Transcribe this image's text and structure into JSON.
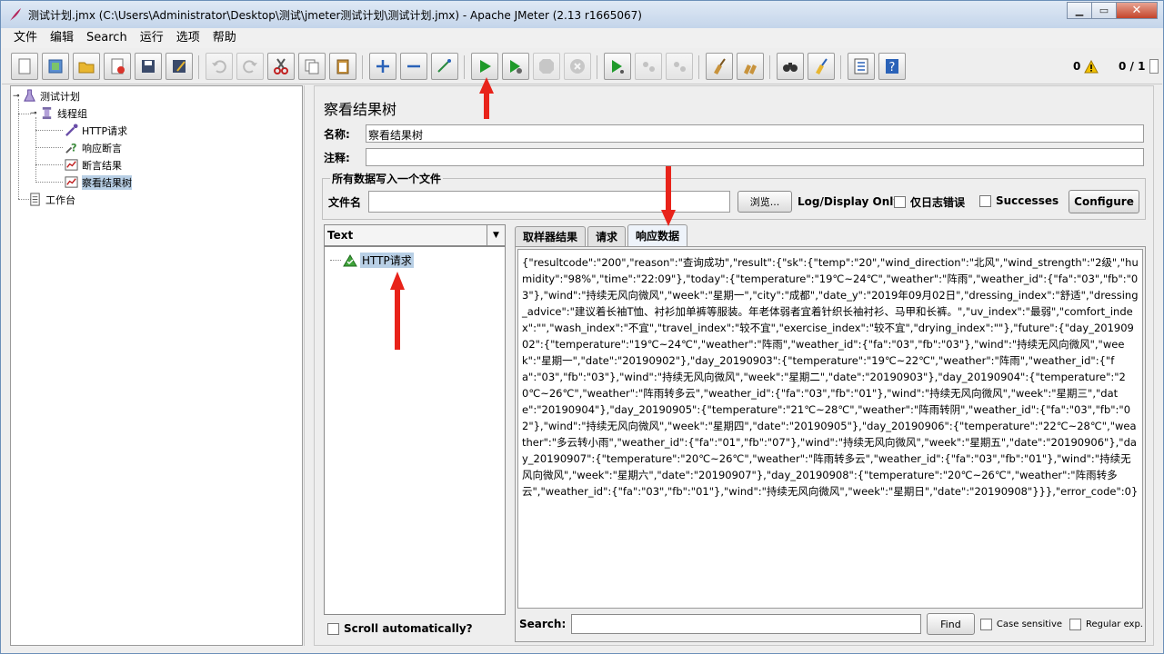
{
  "window": {
    "title": "测试计划.jmx (C:\\Users\\Administrator\\Desktop\\测试\\jmeter测试计划\\测试计划.jmx) - Apache JMeter (2.13 r1665067)"
  },
  "menu": [
    "文件",
    "编辑",
    "Search",
    "运行",
    "选项",
    "帮助"
  ],
  "toolbar": {
    "warning_count": "0",
    "threads": "0 / 1"
  },
  "tree": {
    "root": "测试计划",
    "thread_group": "线程组",
    "http_request": "HTTP请求",
    "response_assertion": "响应断言",
    "assertion_results": "断言结果",
    "view_results_tree": "察看结果树",
    "workbench": "工作台"
  },
  "panel": {
    "title": "察看结果树",
    "name_label": "名称:",
    "name_value": "察看结果树",
    "comment_label": "注释:",
    "comment_value": "",
    "group_title": "所有数据写入一个文件",
    "filename_label": "文件名",
    "filename_value": "",
    "browse_label": "浏览...",
    "log_display_label": "Log/Display Only:",
    "errors_only_label": "仅日志错误",
    "successes_label": "Successes",
    "configure_label": "Configure"
  },
  "results": {
    "renderer": "Text",
    "items": [
      "HTTP请求"
    ],
    "tabs": [
      "取样器结果",
      "请求",
      "响应数据"
    ],
    "active_tab": "响应数据",
    "response_body": "{\"resultcode\":\"200\",\"reason\":\"查询成功\",\"result\":{\"sk\":{\"temp\":\"20\",\"wind_direction\":\"北风\",\"wind_strength\":\"2级\",\"humidity\":\"98%\",\"time\":\"22:09\"},\"today\":{\"temperature\":\"19℃~24℃\",\"weather\":\"阵雨\",\"weather_id\":{\"fa\":\"03\",\"fb\":\"03\"},\"wind\":\"持续无风向微风\",\"week\":\"星期一\",\"city\":\"成都\",\"date_y\":\"2019年09月02日\",\"dressing_index\":\"舒适\",\"dressing_advice\":\"建议着长袖T恤、衬衫加单裤等服装。年老体弱者宜着针织长袖衬衫、马甲和长裤。\",\"uv_index\":\"最弱\",\"comfort_index\":\"\",\"wash_index\":\"不宜\",\"travel_index\":\"较不宜\",\"exercise_index\":\"较不宜\",\"drying_index\":\"\"},\"future\":{\"day_20190902\":{\"temperature\":\"19℃~24℃\",\"weather\":\"阵雨\",\"weather_id\":{\"fa\":\"03\",\"fb\":\"03\"},\"wind\":\"持续无风向微风\",\"week\":\"星期一\",\"date\":\"20190902\"},\"day_20190903\":{\"temperature\":\"19℃~22℃\",\"weather\":\"阵雨\",\"weather_id\":{\"fa\":\"03\",\"fb\":\"03\"},\"wind\":\"持续无风向微风\",\"week\":\"星期二\",\"date\":\"20190903\"},\"day_20190904\":{\"temperature\":\"20℃~26℃\",\"weather\":\"阵雨转多云\",\"weather_id\":{\"fa\":\"03\",\"fb\":\"01\"},\"wind\":\"持续无风向微风\",\"week\":\"星期三\",\"date\":\"20190904\"},\"day_20190905\":{\"temperature\":\"21℃~28℃\",\"weather\":\"阵雨转阴\",\"weather_id\":{\"fa\":\"03\",\"fb\":\"02\"},\"wind\":\"持续无风向微风\",\"week\":\"星期四\",\"date\":\"20190905\"},\"day_20190906\":{\"temperature\":\"22℃~28℃\",\"weather\":\"多云转小雨\",\"weather_id\":{\"fa\":\"01\",\"fb\":\"07\"},\"wind\":\"持续无风向微风\",\"week\":\"星期五\",\"date\":\"20190906\"},\"day_20190907\":{\"temperature\":\"20℃~26℃\",\"weather\":\"阵雨转多云\",\"weather_id\":{\"fa\":\"03\",\"fb\":\"01\"},\"wind\":\"持续无风向微风\",\"week\":\"星期六\",\"date\":\"20190907\"},\"day_20190908\":{\"temperature\":\"20℃~26℃\",\"weather\":\"阵雨转多云\",\"weather_id\":{\"fa\":\"03\",\"fb\":\"01\"},\"wind\":\"持续无风向微风\",\"week\":\"星期日\",\"date\":\"20190908\"}}},\"error_code\":0}",
    "scroll_auto_label": "Scroll automatically?",
    "search_label": "Search:",
    "search_value": "",
    "find_label": "Find",
    "case_sensitive_label": "Case sensitive",
    "regex_label": "Regular exp."
  },
  "colors": {
    "selection": "#b8cfe5",
    "run_green": "#1f9a2a",
    "annotation_red": "#e8231a"
  }
}
